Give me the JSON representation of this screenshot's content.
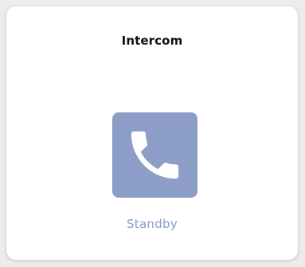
{
  "card": {
    "title": "Intercom",
    "status": "Standby"
  },
  "call_button": {
    "icon": "phone-icon"
  },
  "colors": {
    "accent": "#8c9dc7",
    "status_text": "#8a9cc6",
    "card_background": "#ffffff",
    "page_background": "#ececec",
    "title_text": "#111111"
  }
}
